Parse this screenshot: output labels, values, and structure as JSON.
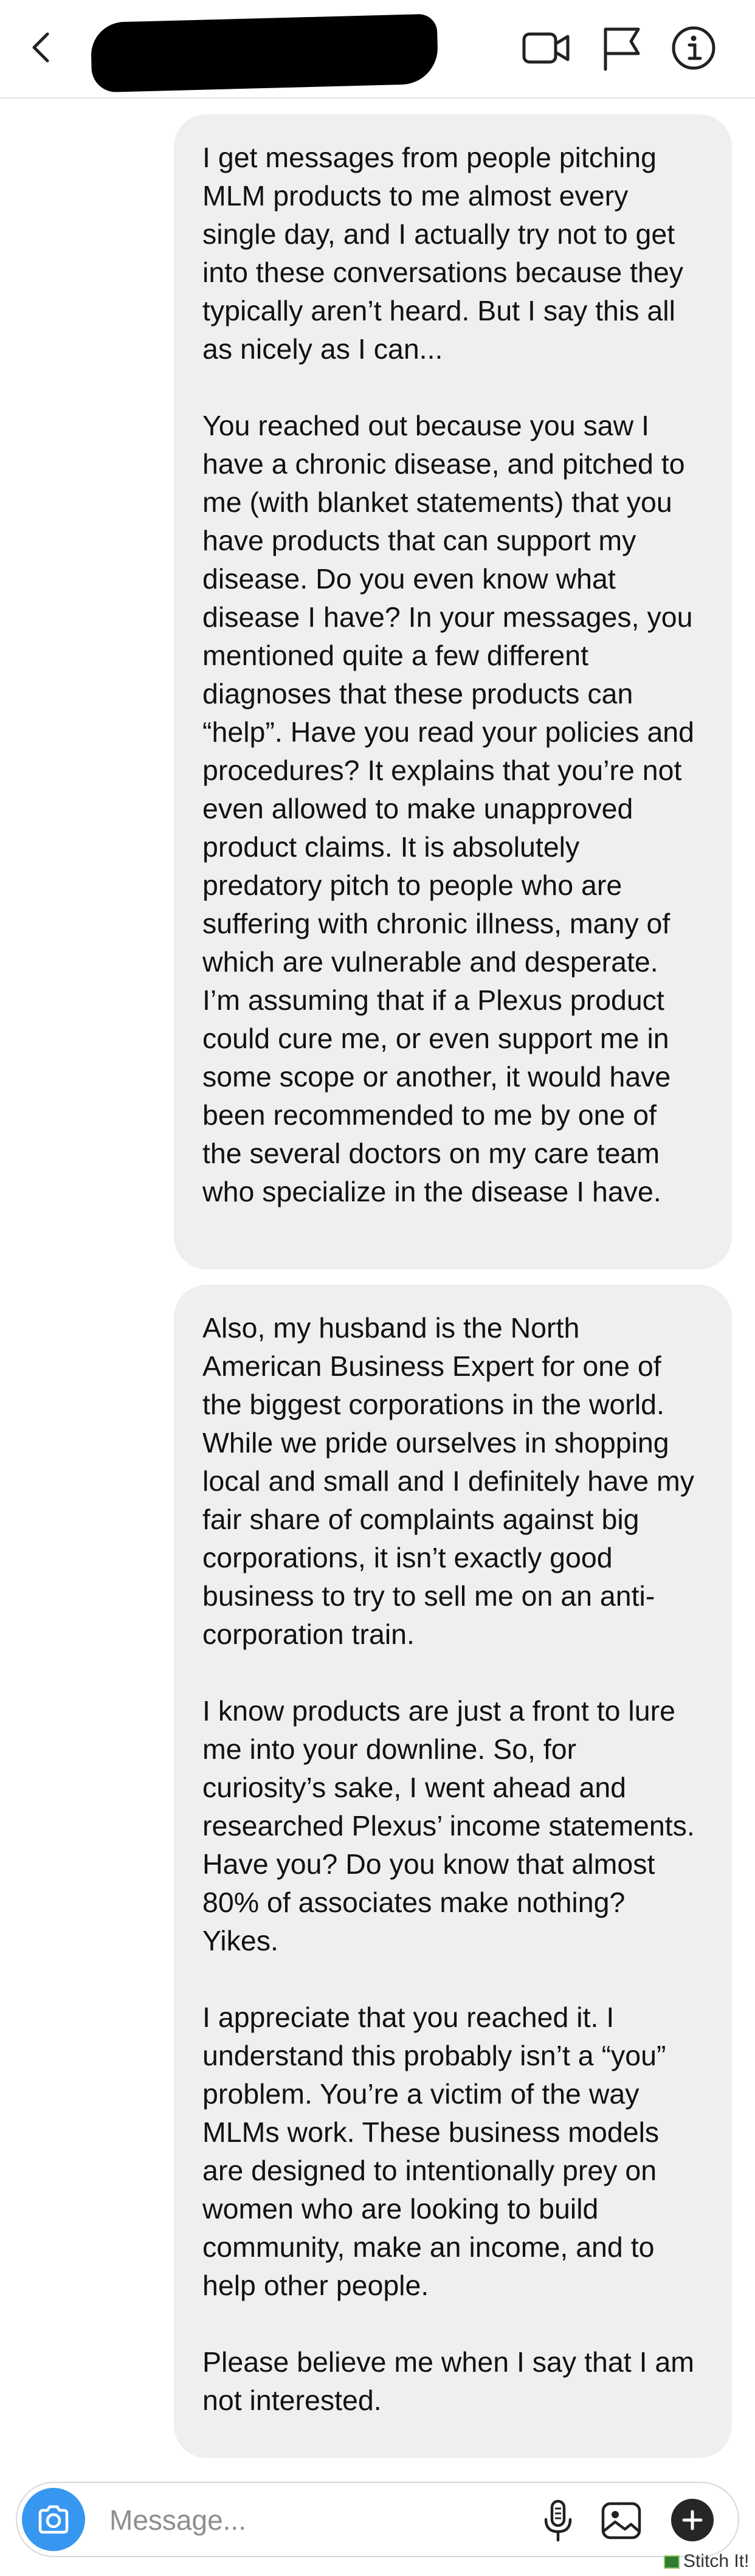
{
  "header": {
    "back_icon": "chevron-left-icon",
    "icons": [
      "video-call-icon",
      "flag-icon",
      "info-icon"
    ]
  },
  "messages": [
    {
      "paragraphs": [
        "I get messages from people pitching MLM products to me almost every single day, and I actually try not to get into these conversations because they typically aren’t heard. But I say this all as nicely as I can...",
        "You reached out because you saw I have a chronic disease, and pitched to me (with blanket statements) that you have products that can support my disease. Do you even know what disease I have? In your messages, you mentioned quite a few different diagnoses that these products can “help”. Have you read your policies and procedures? It explains that you’re not even allowed to make unapproved product claims. It is absolutely predatory pitch to people who are suffering with chronic illness, many of which are vulnerable and desperate. I’m assuming that if a Plexus product could cure me, or even support me in some scope or another, it would have been recommended to me by one of the several doctors on my care team who specialize in the disease I have."
      ]
    },
    {
      "paragraphs": [
        "Also, my husband is the North American Business Expert for one of the biggest corporations in the world. While we pride ourselves in shopping local and small and I definitely have my fair share of complaints against big corporations, it isn’t exactly good business to try to sell me on an anti-corporation train.",
        "I know products are just a front to lure me into your downline. So, for curiosity’s sake, I went ahead and researched Plexus’ income statements. Have you? Do you know that almost 80% of associates make nothing? Yikes.",
        "I appreciate that you reached it. I understand this probably isn’t a “you” problem. You’re a victim of the way MLMs work. These business models are designed to intentionally prey on women who are looking to build community, make an income, and to help other people.",
        "Please believe me when I say that I am not interested."
      ]
    }
  ],
  "composer": {
    "placeholder": "Message...",
    "icons": [
      "camera-icon",
      "microphone-icon",
      "gallery-icon",
      "plus-icon"
    ],
    "accent_color": "#3797f0"
  },
  "watermark": "Stitch It!"
}
